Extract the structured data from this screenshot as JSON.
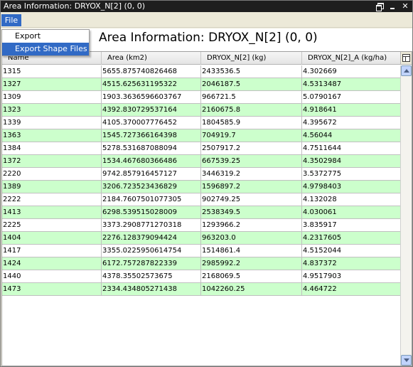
{
  "window": {
    "title": "Area Information: DRYOX_N[2] (0, 0)"
  },
  "menu": {
    "file_label": "File",
    "items": [
      {
        "label": "Export"
      },
      {
        "label": "Export Shape Files"
      }
    ]
  },
  "header": {
    "title": "Area Information: DRYOX_N[2] (0, 0)"
  },
  "table": {
    "columns": [
      "Name",
      "Area (km2)",
      "DRYOX_N[2] (kg)",
      "DRYOX_N[2]_A (kg/ha)"
    ],
    "rows": [
      [
        "1315",
        "5655.875740826468",
        "2433536.5",
        "4.302669"
      ],
      [
        "1327",
        "4515.625631195322",
        "2046187.5",
        "4.5313487"
      ],
      [
        "1309",
        "1903.3636596603767",
        "966721.5",
        "5.0790167"
      ],
      [
        "1323",
        "4392.830729537164",
        "2160675.8",
        "4.918641"
      ],
      [
        "1339",
        "4105.370007776452",
        "1804585.9",
        "4.395672"
      ],
      [
        "1363",
        "1545.727366164398",
        "704919.7",
        "4.56044"
      ],
      [
        "1384",
        "5278.531687088094",
        "2507917.2",
        "4.7511644"
      ],
      [
        "1372",
        "1534.467680366486",
        "667539.25",
        "4.3502984"
      ],
      [
        "2220",
        "9742.857916457127",
        "3446319.2",
        "3.5372775"
      ],
      [
        "1389",
        "3206.723523436829",
        "1596897.2",
        "4.9798403"
      ],
      [
        "2222",
        "2184.7607501077305",
        "902749.25",
        "4.132028"
      ],
      [
        "1413",
        "6298.539515028009",
        "2538349.5",
        "4.030061"
      ],
      [
        "2225",
        "3373.2908771270318",
        "1293966.2",
        "3.835917"
      ],
      [
        "1404",
        "2276.128379094424",
        "963203.0",
        "4.2317605"
      ],
      [
        "1417",
        "3355.0225950614754",
        "1514861.4",
        "4.5152044"
      ],
      [
        "1424",
        "6172.757287822339",
        "2985992.2",
        "4.837372"
      ],
      [
        "1440",
        "4378.35502573675",
        "2168069.5",
        "4.9517903"
      ],
      [
        "1473",
        "2334.434805271438",
        "1042260.25",
        "4.464722"
      ]
    ]
  },
  "colors": {
    "alt_row": "#ccffcc",
    "menu_highlight": "#316ac5",
    "titlebar": "#1e1e1e"
  }
}
